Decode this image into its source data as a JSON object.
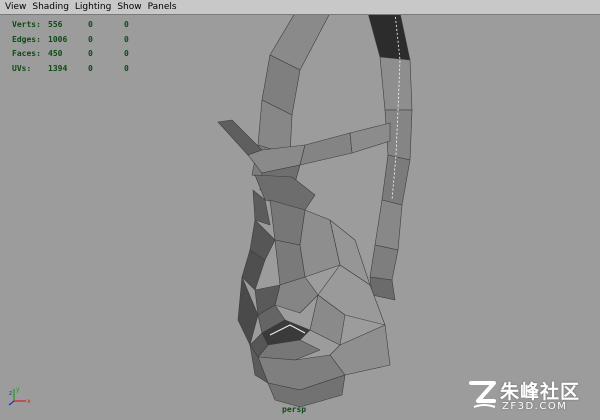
{
  "menu": {
    "items": [
      "View",
      "Shading",
      "Lighting",
      "Show",
      "Panels"
    ]
  },
  "hud": {
    "rows": [
      {
        "label": "Verts:",
        "v1": "556",
        "v2": "0",
        "v3": "0"
      },
      {
        "label": "Edges:",
        "v1": "1006",
        "v2": "0",
        "v3": "0"
      },
      {
        "label": "Faces:",
        "v1": "450",
        "v2": "0",
        "v3": "0"
      },
      {
        "label": "UVs:",
        "v1": "1394",
        "v2": "0",
        "v3": "0"
      }
    ]
  },
  "viewport": {
    "camera_label": "persp",
    "background_color": "#9c9c9c",
    "hud_color": "#0f4a16"
  },
  "axis": {
    "x": "x",
    "y": "y",
    "z": "z"
  },
  "watermark": {
    "brand_cn": "朱峰社区",
    "url": "ZF3D.COM"
  }
}
